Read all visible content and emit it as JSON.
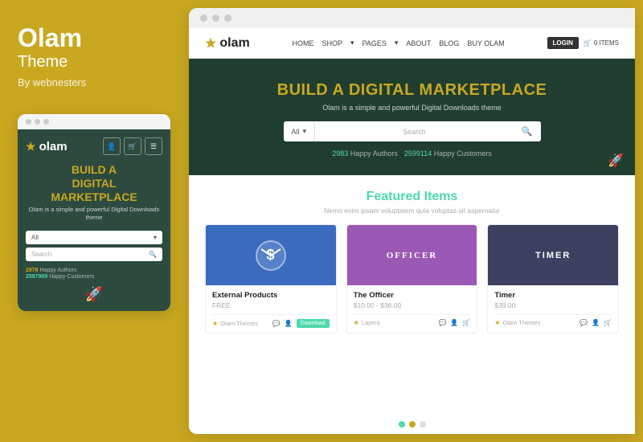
{
  "left": {
    "brand": "Olam",
    "theme": "Theme",
    "by": "By webnesters",
    "mobile_dots": [
      "dot1",
      "dot2",
      "dot3"
    ],
    "mobile_logo": "olam",
    "mobile_hero_line1": "BUILD A",
    "mobile_hero_line2": "DIGITAL",
    "mobile_hero_line3": "MARKETPLACE",
    "mobile_hero_sub": "Olam is a simple and powerful Digital Downloads theme",
    "mobile_select_label": "All",
    "mobile_search_placeholder": "Search",
    "mobile_stat1_num": "2978",
    "mobile_stat1_label": " Happy Authors",
    "mobile_stat2_num": "2597909",
    "mobile_stat2_label": " Happy Customers"
  },
  "right": {
    "nav_logo": "olam",
    "nav_links": [
      "HOME",
      "SHOP",
      "PAGES",
      "ABOUT",
      "BLOG",
      "BUY OLAM"
    ],
    "nav_login": "LOGIN",
    "nav_cart": "0 ITEMS",
    "hero_title_normal": "BUILD A",
    "hero_title_accent": "DIGITAL MARKETPLACE",
    "hero_sub": "Olam is a simple and powerful Digital Downloads theme",
    "search_select": "All",
    "search_placeholder": "Search",
    "stat1_num": "2983",
    "stat1_label": " Happy Authors",
    "stat2_num": "2599114",
    "stat2_label": " Happy Customers",
    "featured_title": "Featured",
    "featured_title_accent": "Items",
    "featured_sub": "Nemo enim ipsam voluptatem quia voluptas sit aspernatur",
    "products": [
      {
        "thumb_label": "",
        "thumb_class": "thumb-blue",
        "name": "External Products",
        "price": "FREE",
        "author": "Olam Themes",
        "has_download": true,
        "download_label": "Download"
      },
      {
        "thumb_label": "OFFICER",
        "thumb_class": "thumb-purple",
        "name": "The Officer",
        "price": "$10.00 - $36.00",
        "author": "Layero",
        "has_download": false,
        "download_label": ""
      },
      {
        "thumb_label": "TIMER",
        "thumb_class": "thumb-dark",
        "name": "Timer",
        "price": "$39.00",
        "author": "Olam Themes",
        "has_download": false,
        "download_label": ""
      }
    ],
    "bottom_dots": [
      "teal",
      "yellow",
      "gray"
    ]
  }
}
